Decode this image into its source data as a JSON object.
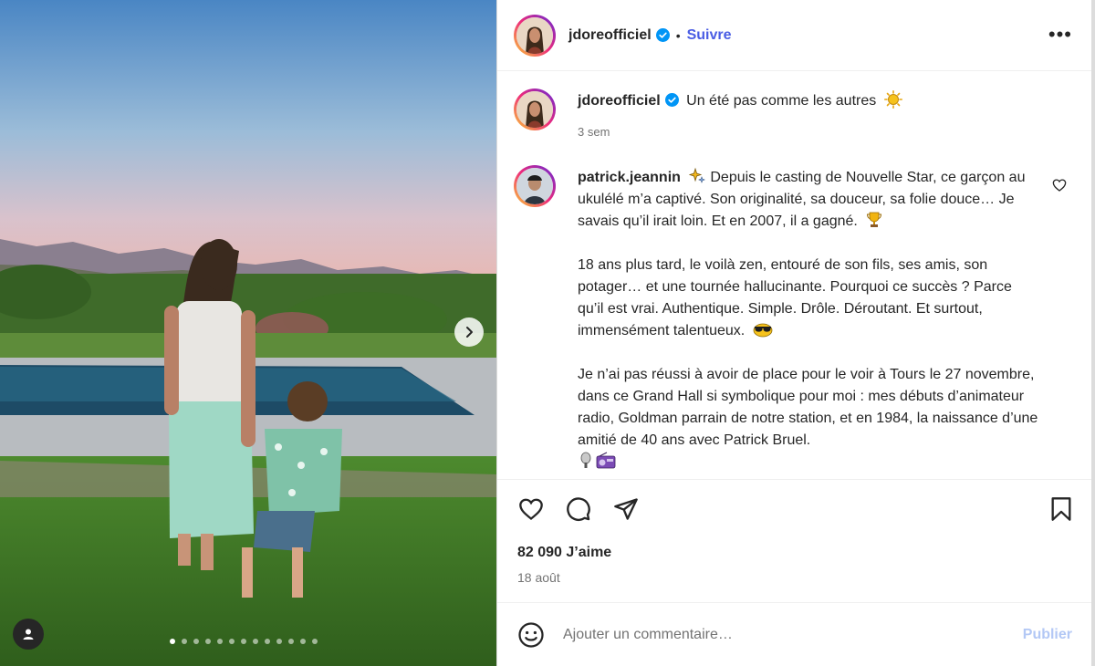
{
  "post": {
    "author": "jdoreofficiel",
    "follow_label": "Suivre",
    "separator": "•",
    "more_label": "•••",
    "caption_text": "Un été pas comme les autres",
    "caption_emoji": "sun-emoji",
    "caption_time": "3 sem",
    "carousel": {
      "dot_count": 13,
      "active_dot": 0
    }
  },
  "comment": {
    "username": "patrick.jeannin",
    "paragraphs": [
      "Depuis le casting de Nouvelle Star, ce garçon au ukulélé m’a captivé. Son originalité, sa douceur, sa folie douce… Je savais qu’il irait loin. Et en 2007, il a gagné.",
      "18 ans plus tard, le voilà zen, entouré de son fils, ses amis, son potager… et une tournée hallucinante. Pourquoi ce succès ? Parce qu’il est vrai. Authentique. Simple. Drôle. Déroutant. Et surtout, immensément talentueux.",
      "Je n’ai pas réussi à avoir de place pour le voir à Tours le 27 novembre, dans ce Grand Hall si symbolique pour moi : mes débuts d’animateur radio, Goldman parrain de notre station, et en 1984, la naissance d’une amitié de 40 ans avec Patrick Bruel."
    ]
  },
  "stats": {
    "likes": "82 090 J’aime",
    "date": "18 août"
  },
  "add_comment": {
    "placeholder": "Ajouter un commentaire…",
    "publish_label": "Publier"
  },
  "colors": {
    "link_blue": "#4a5de4",
    "publish_disabled": "#b3c8f5",
    "verified": "#0095f6"
  }
}
